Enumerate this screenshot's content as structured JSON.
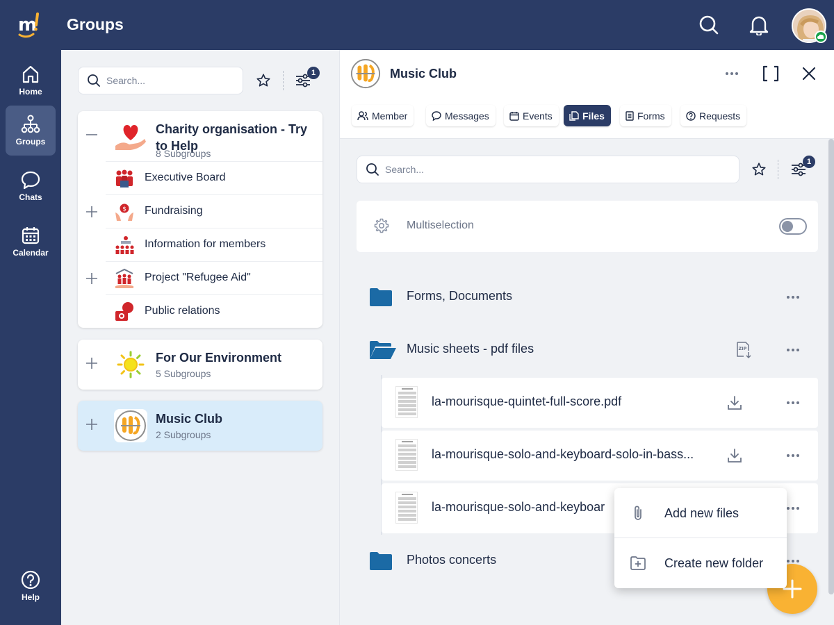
{
  "header": {
    "app_title": "Groups",
    "icons": [
      "search-icon",
      "bell-icon",
      "avatar",
      "cloud-status-icon"
    ]
  },
  "sidebar": {
    "items": [
      {
        "label": "Home",
        "icon": "home-icon"
      },
      {
        "label": "Groups",
        "icon": "groups-icon",
        "active": true
      },
      {
        "label": "Chats",
        "icon": "chat-icon"
      },
      {
        "label": "Calendar",
        "icon": "calendar-icon"
      }
    ],
    "help": {
      "label": "Help",
      "icon": "help-icon"
    }
  },
  "groups_panel": {
    "search_placeholder": "Search...",
    "filter_badge": "1",
    "groups": [
      {
        "title": "Charity organisation - Try to Help",
        "subtitle": "8 Subgroups",
        "expanded": true,
        "subgroups": [
          {
            "label": "Executive Board",
            "expandable": false
          },
          {
            "label": "Fundraising",
            "expandable": true
          },
          {
            "label": "Information for members",
            "expandable": false
          },
          {
            "label": "Project \"Refugee Aid\"",
            "expandable": true
          },
          {
            "label": "Public relations",
            "expandable": false
          }
        ]
      },
      {
        "title": "For Our Environment",
        "subtitle": "5 Subgroups",
        "expanded": false
      },
      {
        "title": "Music Club",
        "subtitle": "2 Subgroups",
        "expanded": false,
        "selected": true
      }
    ]
  },
  "detail": {
    "title": "Music Club",
    "tabs": [
      {
        "label": "Member",
        "icon": "people-icon"
      },
      {
        "label": "Messages",
        "icon": "message-icon"
      },
      {
        "label": "Events",
        "icon": "calendar-icon"
      },
      {
        "label": "Files",
        "icon": "files-icon",
        "active": true
      },
      {
        "label": "Forms",
        "icon": "form-icon"
      },
      {
        "label": "Requests",
        "icon": "question-icon"
      }
    ],
    "search_placeholder": "Search...",
    "filter_badge": "1",
    "multiselection_label": "Multiselection",
    "multiselection_on": false,
    "folders": [
      {
        "name": "Forms, Documents",
        "open": false
      },
      {
        "name": "Music sheets - pdf files",
        "open": true
      },
      {
        "name": "Photos concerts",
        "open": false
      }
    ],
    "files": [
      {
        "name": "la-mourisque-quintet-full-score.pdf"
      },
      {
        "name": "la-mourisque-solo-and-keyboard-solo-in-bass..."
      },
      {
        "name": "la-mourisque-solo-and-keyboar"
      }
    ],
    "context_menu": [
      {
        "label": "Add new files",
        "icon": "paperclip-icon"
      },
      {
        "label": "Create new folder",
        "icon": "new-folder-icon"
      }
    ]
  },
  "colors": {
    "navy": "#2b3c66",
    "folder_blue": "#1b6aa5",
    "fab_orange": "#f9b233",
    "selected_bg": "#d9ecfa"
  }
}
